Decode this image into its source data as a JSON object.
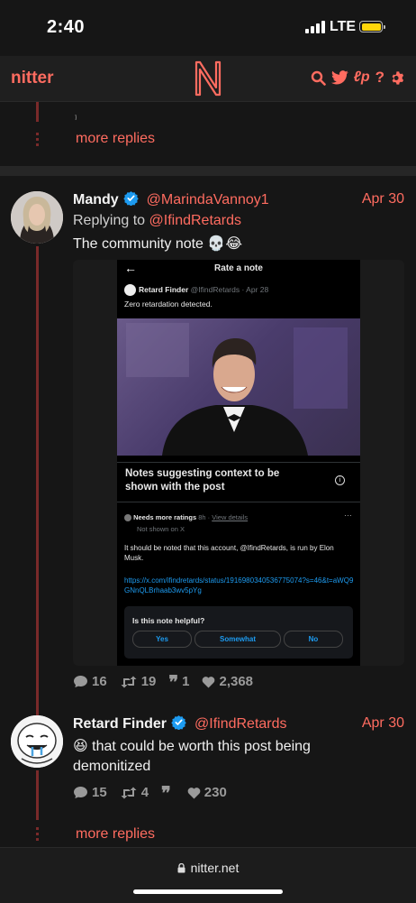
{
  "status_bar": {
    "time": "2:40",
    "network": "LTE"
  },
  "nav": {
    "brand": "nitter",
    "logo_letter": "N",
    "icons": [
      "search-icon",
      "twitter-bird-icon",
      "lp-icon",
      "help-icon",
      "settings-gear-icon"
    ]
  },
  "top_thread": {
    "more_replies": "more replies"
  },
  "tweet1": {
    "name": "Mandy",
    "handle": "@MarindaVannoy1",
    "date": "Apr 30",
    "replying_prefix": "Replying to",
    "replying_to": "@IfindRetards",
    "text": "The community note 💀😂",
    "screenshot": {
      "header": "Rate a note",
      "post_name": "Retard Finder",
      "post_handle": "@IfindRetards · Apr 28",
      "post_text": "Zero retardation detected.",
      "notes_title": "Notes suggesting context to be shown with the post",
      "needs_more": "Needs more ratings",
      "age": "8h ·",
      "view_details": "View details",
      "not_shown": "Not shown on X",
      "note_body": "It should be noted that this account, @IfindRetards, is run by Elon Musk.",
      "note_link": "https://x.com/ifindretards/status/1916980340536775074?s=46&t=aWQ9GNnQLBrhaab3wv5pYg",
      "helpful_q": "Is this note helpful?",
      "buttons": [
        "Yes",
        "Somewhat",
        "No"
      ]
    },
    "stats": {
      "comments": "16",
      "retweets": "19",
      "quotes": "1",
      "likes": "2,368"
    }
  },
  "tweet2": {
    "name": "Retard Finder",
    "handle": "@IfindRetards",
    "date": "Apr 30",
    "text": "😆 that could be worth this post being demonitized",
    "stats": {
      "comments": "15",
      "retweets": "4",
      "quotes": "",
      "likes": "230"
    }
  },
  "bottom_thread": {
    "more_replies": "more replies"
  },
  "browser": {
    "url": "nitter.net"
  },
  "colors": {
    "accent": "#ff6c60",
    "background": "#161616",
    "verified": "#1d9bf0",
    "thread": "#7a2a2a"
  }
}
